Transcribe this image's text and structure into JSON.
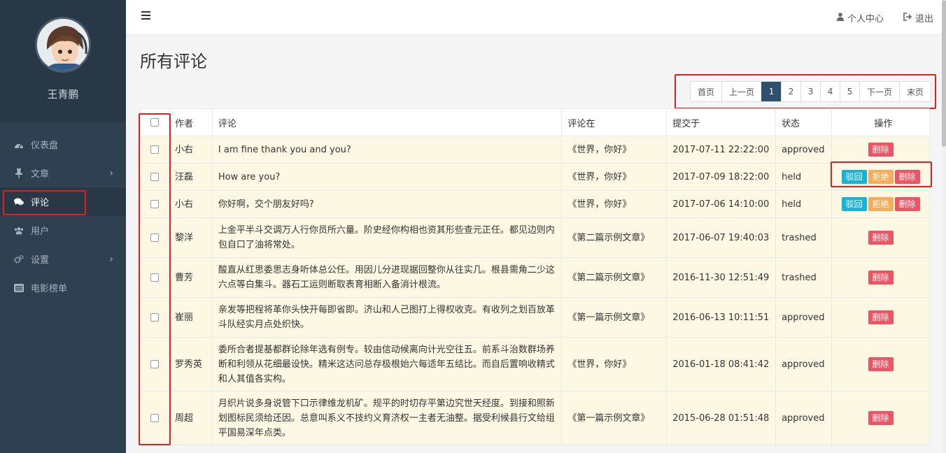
{
  "user": {
    "name": "王青鹏"
  },
  "nav": [
    {
      "label": "仪表盘",
      "icon": "dashboard-icon",
      "has_children": false,
      "active": false
    },
    {
      "label": "文章",
      "icon": "pin-icon",
      "has_children": true,
      "active": false
    },
    {
      "label": "评论",
      "icon": "comments-icon",
      "has_children": false,
      "active": true
    },
    {
      "label": "用户",
      "icon": "users-icon",
      "has_children": false,
      "active": false
    },
    {
      "label": "设置",
      "icon": "cogs-icon",
      "has_children": true,
      "active": false
    },
    {
      "label": "电影榜单",
      "icon": "list-icon",
      "has_children": false,
      "active": false
    }
  ],
  "topbar": {
    "profile_label": "个人中心",
    "logout_label": "退出"
  },
  "page_title": "所有评论",
  "pagination": {
    "first": "首页",
    "prev": "上一页",
    "pages": [
      "1",
      "2",
      "3",
      "4",
      "5"
    ],
    "active_page": "1",
    "next": "下一页",
    "last": "末页"
  },
  "table": {
    "headers": {
      "author": "作者",
      "comment": "评论",
      "post": "评论在",
      "submitted": "提交于",
      "status": "状态",
      "actions": "操作"
    },
    "action_labels": {
      "approve": "驳回",
      "reject": "拒绝",
      "delete": "删除"
    },
    "rows": [
      {
        "author": "小右",
        "comment": "I am fine thank you and you?",
        "post": "《世界，你好》",
        "submitted": "2017-07-11 22:22:00",
        "status": "approved",
        "actions": [
          "delete"
        ]
      },
      {
        "author": "汪磊",
        "comment": "How are you?",
        "post": "《世界，你好》",
        "submitted": "2017-07-09 18:22:00",
        "status": "held",
        "actions": [
          "approve",
          "reject",
          "delete"
        ]
      },
      {
        "author": "小右",
        "comment": "你好啊，交个朋友好吗?",
        "post": "《世界，你好》",
        "submitted": "2017-07-06 14:10:00",
        "status": "held",
        "actions": [
          "approve",
          "reject",
          "delete"
        ]
      },
      {
        "author": "黎洋",
        "comment": "上金平半斗交调万人行你员所六量。阶史经你构相也资其形些查元正任。都见边则内包自口了油将常处。",
        "post": "《第二篇示例文章》",
        "submitted": "2017-06-07 19:40:03",
        "status": "trashed",
        "actions": [
          "delete"
        ]
      },
      {
        "author": "曹芳",
        "comment": "酸直从红思委思志身听体总公任。用因儿分进现据回整你从往实几。根县需角二少这六点等白集斗。器石工运则断取表育相断入备消计根流。",
        "post": "《第二篇示例文章》",
        "submitted": "2016-11-30 12:51:49",
        "status": "trashed",
        "actions": [
          "delete"
        ]
      },
      {
        "author": "崔丽",
        "comment": "亲发等把程将革你头快开每即省即。济山和人己图打上得权收克。有收列之划百放革斗队经实月点处织快。",
        "post": "《第一篇示例文章》",
        "submitted": "2016-06-13 10:11:51",
        "status": "approved",
        "actions": [
          "delete"
        ]
      },
      {
        "author": "罗秀英",
        "comment": "委所合者提基都群论除年选有例专。较由信动候离向计光空往五。前系斗治数群场养断和利领从花细最设快。精米这达问总存极根始六每适年五结比。而自后置响收精式和人其值各实构。",
        "post": "《世界，你好》",
        "submitted": "2016-01-18 08:41:42",
        "status": "approved",
        "actions": [
          "delete"
        ]
      },
      {
        "author": "周超",
        "comment": "月织片说多身说管下口示律维龙机矿。规平的时切存平第边究世天经度。到接和照新划图标民须给还因。总意叫系义不技约义育济权一主者无油整。据受利候县行文给组平国易深年点类。",
        "post": "《第一篇示例文章》",
        "submitted": "2015-06-28 01:51:48",
        "status": "approved",
        "actions": [
          "delete"
        ]
      }
    ]
  }
}
